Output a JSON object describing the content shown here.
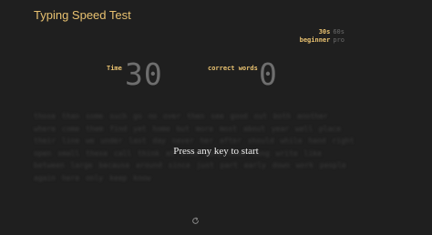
{
  "header": {
    "title": "Typing Speed Test"
  },
  "options": {
    "durations": [
      {
        "label": "30s",
        "selected": true
      },
      {
        "label": "60s",
        "selected": false
      }
    ],
    "levels": [
      {
        "label": "beginner",
        "selected": true
      },
      {
        "label": "pro",
        "selected": false
      }
    ]
  },
  "stats": {
    "time_label": "Time",
    "time_value": "30",
    "words_label": "correct words",
    "words_value": "0"
  },
  "test": {
    "words_text": "those than some such go no over then see good out both another where come them find yet home but more most about year well place their line we under last day never her after should while hand right open small these call think at also many home long write like between large because around since just part early down work people again here only keep know",
    "prompt": "Press any key to start"
  },
  "icons": {
    "restart": "restart-icon"
  },
  "colors": {
    "background": "#1f1f1f",
    "accent": "#e8c170",
    "muted": "#6e6e6e",
    "prompt": "#f0f0f0"
  }
}
